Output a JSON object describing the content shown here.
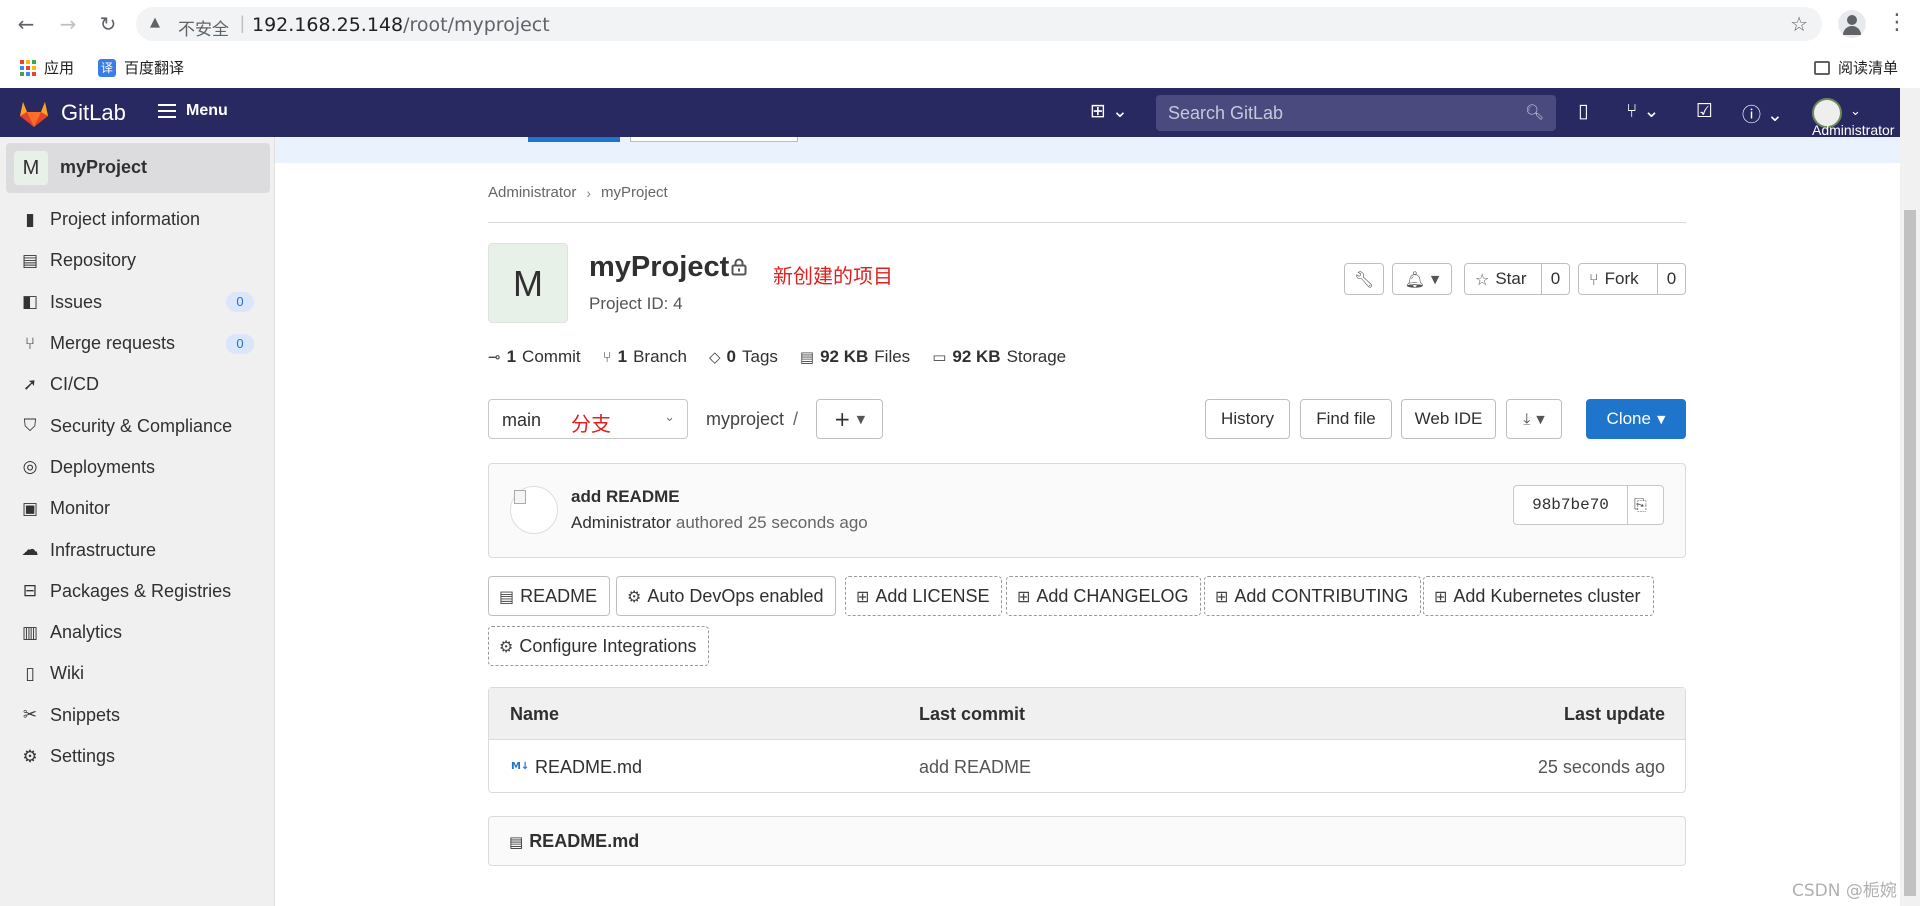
{
  "browser": {
    "insecure_label": "不安全",
    "url_host": "192.168.25.148",
    "url_path": "/root/myproject",
    "bookmarks": [
      {
        "label": "应用"
      },
      {
        "label": "百度翻译"
      }
    ],
    "reading_list": "阅读清单"
  },
  "topbar": {
    "brand": "GitLab",
    "menu_label": "Menu",
    "search_placeholder": "Search GitLab",
    "user_label": "Administrator",
    "brand_color": "#292961"
  },
  "sidebar": {
    "project_avatar": "M",
    "project_name": "myProject",
    "items": [
      {
        "label": "Project information",
        "icon": "project-info-icon"
      },
      {
        "label": "Repository",
        "icon": "repository-icon"
      },
      {
        "label": "Issues",
        "icon": "issues-icon",
        "count": "0"
      },
      {
        "label": "Merge requests",
        "icon": "merge-request-icon",
        "count": "0"
      },
      {
        "label": "CI/CD",
        "icon": "rocket-icon"
      },
      {
        "label": "Security & Compliance",
        "icon": "shield-icon"
      },
      {
        "label": "Deployments",
        "icon": "deployments-icon"
      },
      {
        "label": "Monitor",
        "icon": "monitor-icon"
      },
      {
        "label": "Infrastructure",
        "icon": "cloud-icon"
      },
      {
        "label": "Packages & Registries",
        "icon": "package-icon"
      },
      {
        "label": "Analytics",
        "icon": "chart-icon"
      },
      {
        "label": "Wiki",
        "icon": "book-icon"
      },
      {
        "label": "Snippets",
        "icon": "scissors-icon"
      },
      {
        "label": "Settings",
        "icon": "gear-icon"
      }
    ]
  },
  "breadcrumb": {
    "items": [
      "Administrator",
      "myProject"
    ]
  },
  "project": {
    "avatar": "M",
    "title": "myProject",
    "annotation": "新创建的项目",
    "id_label": "Project ID: 4",
    "star_label": "Star",
    "star_count": "0",
    "fork_label": "Fork",
    "fork_count": "0"
  },
  "stats": {
    "commits_count": "1",
    "commits_label": "Commit",
    "branches_count": "1",
    "branches_label": "Branch",
    "tags_count": "0",
    "tags_label": "Tags",
    "files_size": "92 KB",
    "files_label": "Files",
    "storage_size": "92 KB",
    "storage_label": "Storage"
  },
  "repo_toolbar": {
    "branch": "main",
    "branch_annotation": "分支",
    "path": "myproject",
    "path_sep": "/",
    "history": "History",
    "find_file": "Find file",
    "web_ide": "Web IDE",
    "clone": "Clone",
    "accent": "#1f75cb"
  },
  "last_commit": {
    "title": "add README",
    "author": "Administrator",
    "meta": "authored 25 seconds ago",
    "sha": "98b7be70"
  },
  "quick_actions": [
    {
      "label": "README",
      "icon": "file-icon",
      "dashed": false
    },
    {
      "label": "Auto DevOps enabled",
      "icon": "gear-icon",
      "dashed": false
    },
    {
      "label": "Add LICENSE",
      "icon": "plus-square-icon",
      "dashed": true
    },
    {
      "label": "Add CHANGELOG",
      "icon": "plus-square-icon",
      "dashed": true
    },
    {
      "label": "Add CONTRIBUTING",
      "icon": "plus-square-icon",
      "dashed": true
    },
    {
      "label": "Add Kubernetes cluster",
      "icon": "plus-square-icon",
      "dashed": true
    },
    {
      "label": "Configure Integrations",
      "icon": "gear-icon",
      "dashed": true
    }
  ],
  "file_table": {
    "headers": {
      "name": "Name",
      "last_commit": "Last commit",
      "last_update": "Last update"
    },
    "rows": [
      {
        "name": "README.md",
        "icon": "M↓",
        "commit": "add README",
        "updated": "25 seconds ago"
      }
    ]
  },
  "readme": {
    "title": "README.md"
  },
  "watermark": "CSDN @栀婉"
}
